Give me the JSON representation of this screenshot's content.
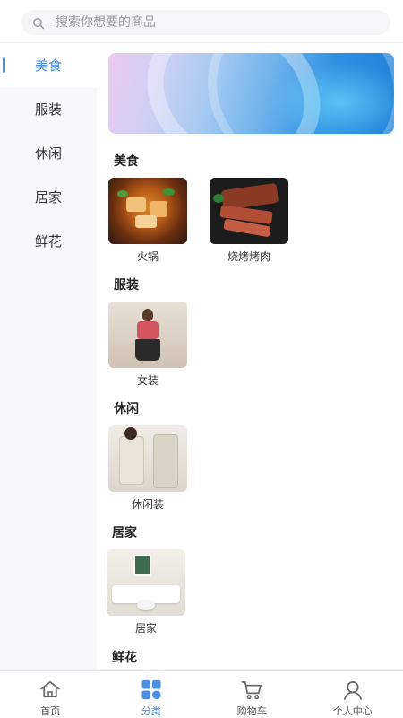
{
  "search": {
    "placeholder": "搜索你想要的商品"
  },
  "sidebar": {
    "items": [
      {
        "label": "美食",
        "active": true
      },
      {
        "label": "服装",
        "active": false
      },
      {
        "label": "休闲",
        "active": false
      },
      {
        "label": "居家",
        "active": false
      },
      {
        "label": "鲜花",
        "active": false
      }
    ]
  },
  "sections": [
    {
      "title": "美食",
      "products": [
        {
          "label": "火锅"
        },
        {
          "label": "烧烤烤肉"
        }
      ]
    },
    {
      "title": "服装",
      "products": [
        {
          "label": "女装"
        }
      ]
    },
    {
      "title": "休闲",
      "products": [
        {
          "label": "休闲装"
        }
      ]
    },
    {
      "title": "居家",
      "products": [
        {
          "label": "居家"
        }
      ]
    },
    {
      "title": "鲜花",
      "products": []
    }
  ],
  "tabbar": {
    "items": [
      {
        "label": "首页",
        "icon": "home-icon",
        "active": false
      },
      {
        "label": "分类",
        "icon": "category-icon",
        "active": true
      },
      {
        "label": "购物车",
        "icon": "cart-icon",
        "active": false
      },
      {
        "label": "个人中心",
        "icon": "user-icon",
        "active": false
      }
    ]
  },
  "colors": {
    "accent": "#4a90e2",
    "sidebar_bg": "#f7f8fa"
  }
}
